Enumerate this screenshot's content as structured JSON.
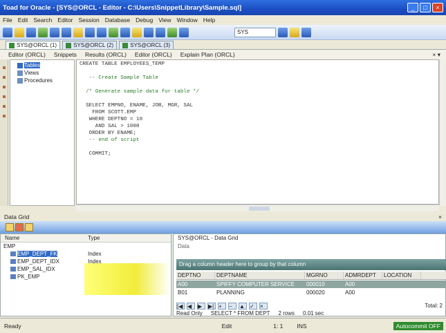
{
  "window": {
    "title": "Toad for Oracle - [SYS@ORCL - Editor - C:\\Users\\SnippetLibrary\\Sample.sql]",
    "min": "_",
    "max": "□",
    "close": "×"
  },
  "menu": [
    "File",
    "Edit",
    "Search",
    "Editor",
    "Session",
    "Database",
    "Debug",
    "View",
    "Window",
    "Help"
  ],
  "toolbar": {
    "schema_select": "SYS"
  },
  "doc_tabs": [
    "SYS@ORCL (1)",
    "SYS@ORCL (2)",
    "SYS@ORCL (3)"
  ],
  "editor_tabs": {
    "items": [
      "Editor (ORCL)",
      "Snippets",
      "Results (ORCL)",
      "Editor (ORCL)",
      "Explain Plan (ORCL)"
    ],
    "close": "× ▾"
  },
  "tree": [
    {
      "label": "Tables",
      "selected": true
    },
    {
      "label": "Views",
      "selected": false
    },
    {
      "label": "Procedures",
      "selected": false
    }
  ],
  "editor": {
    "lines": [
      "CREATE TABLE EMPLOYEES_TEMP",
      "",
      "   -- Create Sample Table",
      "",
      "  /* Generate sample data for table */",
      "",
      "  SELECT EMPNO, ENAME, JOB, MGR, SAL",
      "    FROM SCOTT.EMP",
      "   WHERE DEPTNO = 10",
      "     AND SAL > 1000",
      "   ORDER BY ENAME;",
      "   -- end of script",
      "",
      "   COMMIT;"
    ]
  },
  "bottom_panel": {
    "title": "Data Grid",
    "close": "×"
  },
  "left_grid": {
    "headers": [
      "Name",
      "Type"
    ],
    "rows": [
      {
        "name": "EMP",
        "type": "",
        "expanded": true
      },
      {
        "name": "EMP_DEPT_FK",
        "type": "Index",
        "selected": true
      },
      {
        "name": "EMP_DEPT_IDX",
        "type": "Index"
      },
      {
        "name": "EMP_SAL_IDX",
        "type": "Index"
      },
      {
        "name": "PK_EMP",
        "type": "Index"
      }
    ]
  },
  "right_panel": {
    "path": "SYS@ORCL - Data Grid",
    "sub": "Data",
    "group_header": "Drag a column header here to group by that column",
    "columns": [
      "DEPTNO",
      "DEPTNAME",
      "MGRNO",
      "ADMRDEPT",
      "LOCATION"
    ],
    "rows": [
      {
        "cells": [
          "A00",
          "SPIFFY COMPUTER SERVICE DIV.",
          "000010",
          "A00",
          ""
        ],
        "selected": true
      },
      {
        "cells": [
          "B01",
          "PLANNING",
          "000020",
          "A00",
          ""
        ],
        "selected": false
      }
    ],
    "nav": [
      "|◀",
      "◀",
      "▶",
      "▶|",
      "+",
      "−",
      "▲",
      "✓",
      "×"
    ],
    "total": "Total: 2",
    "footer": [
      "Read Only",
      "SELECT * FROM DEPT",
      "2 rows",
      "0.01 sec"
    ]
  },
  "status": {
    "left": "Ready",
    "mid": "Edit",
    "pos": "1: 1",
    "ins": "INS",
    "badge": "Autocommit OFF"
  }
}
